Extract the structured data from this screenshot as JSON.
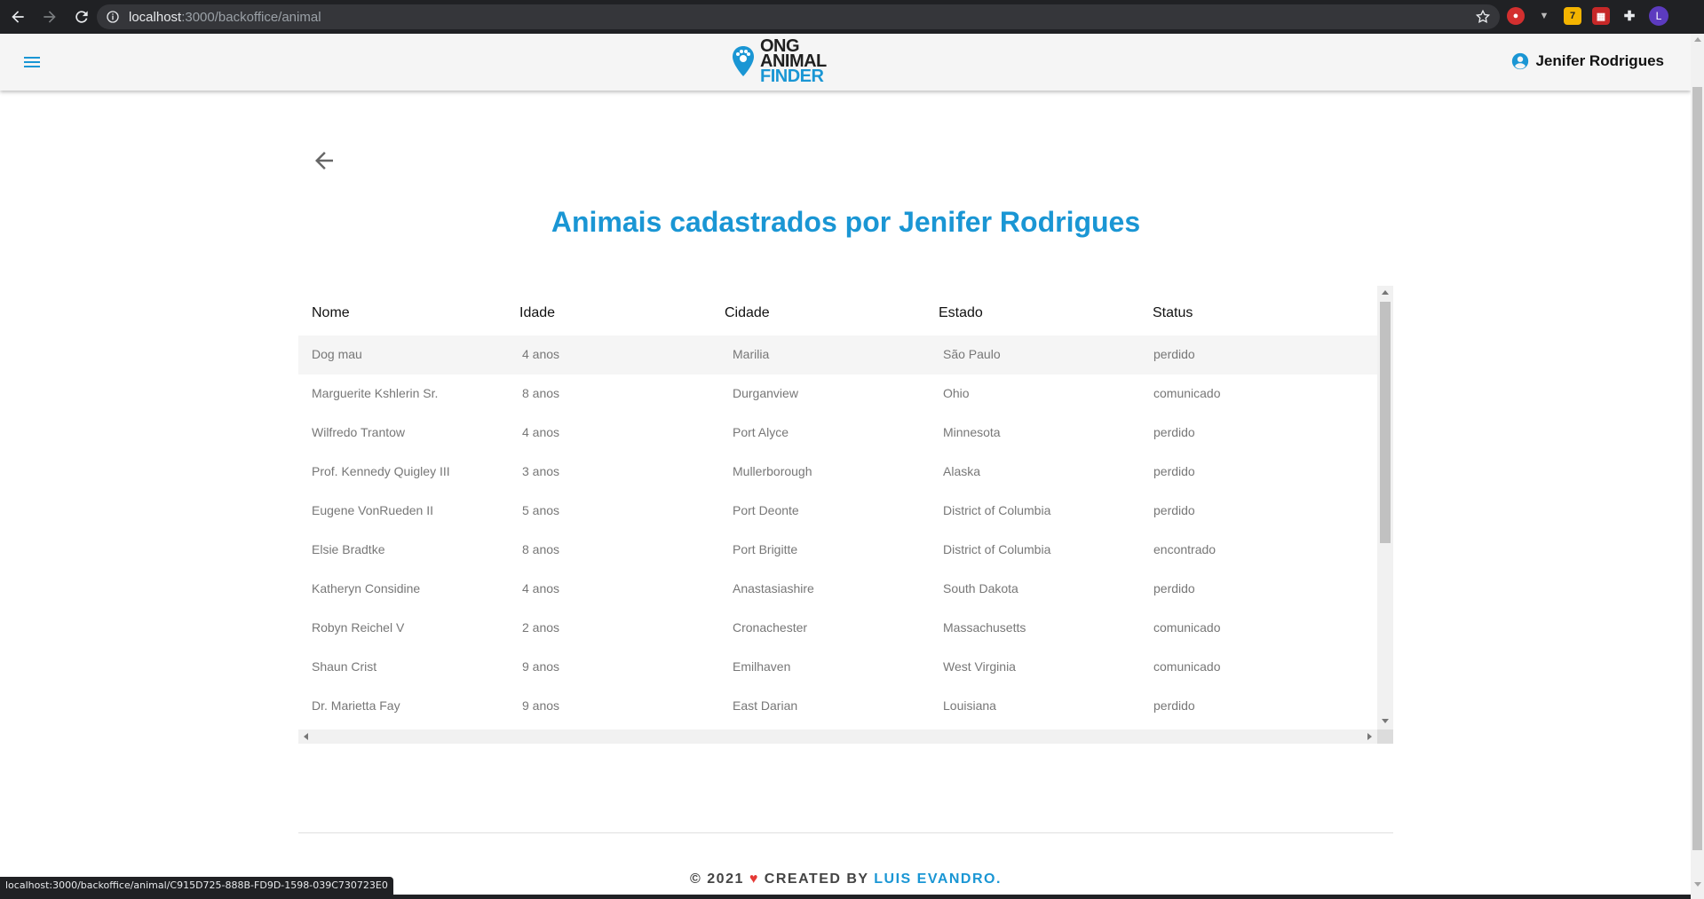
{
  "browser": {
    "url_host": "localhost",
    "url_path": ":3000/backoffice/animal",
    "status_url": "localhost:3000/backoffice/animal/C915D725-888B-FD9D-1598-039C730723E0",
    "profile_initial": "L",
    "ext_badge": "7"
  },
  "header": {
    "logo": {
      "line1": "ONG",
      "line2": "ANIMAL",
      "line3": "FINDER"
    },
    "user_name": "Jenifer Rodrigues"
  },
  "page": {
    "title": "Animais cadastrados por Jenifer Rodrigues"
  },
  "table": {
    "columns": [
      "Nome",
      "Idade",
      "Cidade",
      "Estado",
      "Status"
    ],
    "rows": [
      [
        "Dog mau",
        "4 anos",
        "Marilia",
        "São Paulo",
        "perdido"
      ],
      [
        "Marguerite Kshlerin Sr.",
        "8 anos",
        "Durganview",
        "Ohio",
        "comunicado"
      ],
      [
        "Wilfredo Trantow",
        "4 anos",
        "Port Alyce",
        "Minnesota",
        "perdido"
      ],
      [
        "Prof. Kennedy Quigley III",
        "3 anos",
        "Mullerborough",
        "Alaska",
        "perdido"
      ],
      [
        "Eugene VonRueden II",
        "5 anos",
        "Port Deonte",
        "District of Columbia",
        "perdido"
      ],
      [
        "Elsie Bradtke",
        "8 anos",
        "Port Brigitte",
        "District of Columbia",
        "encontrado"
      ],
      [
        "Katheryn Considine",
        "4 anos",
        "Anastasiashire",
        "South Dakota",
        "perdido"
      ],
      [
        "Robyn Reichel V",
        "2 anos",
        "Cronachester",
        "Massachusetts",
        "comunicado"
      ],
      [
        "Shaun Crist",
        "9 anos",
        "Emilhaven",
        "West Virginia",
        "comunicado"
      ],
      [
        "Dr. Marietta Fay",
        "9 anos",
        "East Darian",
        "Louisiana",
        "perdido"
      ]
    ]
  },
  "footer": {
    "prefix": "© 2021",
    "heart": "♥",
    "middle": "CREATED BY",
    "author": "LUIS EVANDRO",
    "suffix": "."
  },
  "colors": {
    "accent": "#1a96d4",
    "chrome": "#202124",
    "header_bg": "#f5f5f5"
  }
}
